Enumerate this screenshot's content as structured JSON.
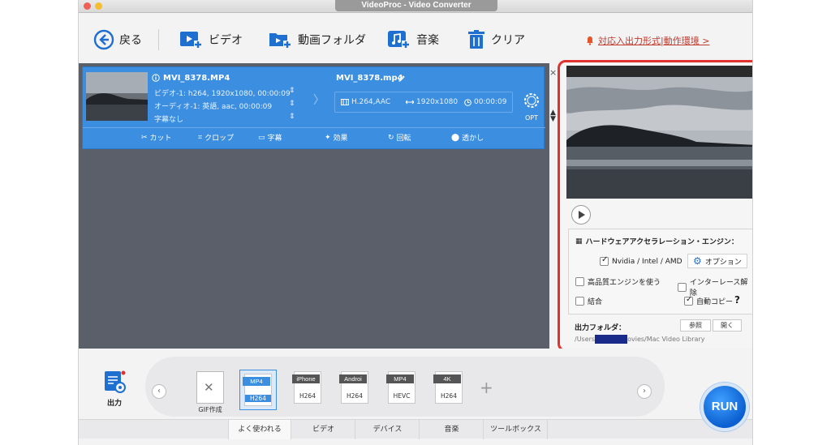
{
  "window": {
    "title": "VideoProc - Video Converter"
  },
  "toolbar": {
    "back": "戻る",
    "video": "ビデオ",
    "folder": "動画フォルダ",
    "music": "音楽",
    "clear": "クリア",
    "support_link": "対応入出力形式|動作環境 >"
  },
  "task": {
    "source_name": "MVI_8378.MP4",
    "video_track": "ビデオ-1: h264, 1920x1080, 00:00:09",
    "audio_track": "オーディオ-1: 英語, aac, 00:00:09",
    "subtitle": "字幕なし",
    "output_name": "MVI_8378.mp4",
    "codec": "H.264,AAC",
    "resolution": "1920x1080",
    "duration": "00:00:09",
    "opt_label": "OPT",
    "tools": {
      "cut": "カット",
      "crop": "クロップ",
      "subtitles": "字幕",
      "effects": "効果",
      "rotate": "回転",
      "watermark": "透かし"
    }
  },
  "panel": {
    "hw_title": "ハードウェアアクセラレーション・エンジン：",
    "nvidia": "Nvidia / Intel / AMD",
    "option": "オプション",
    "hq_engine": "高品質エンジンを使う",
    "deinterlace": "インターレース解除",
    "merge": "結合",
    "auto_copy": "自動コピー",
    "help": "?",
    "output_folder": "出力フォルダ：",
    "browse": "参照",
    "open": "開く",
    "path_prefix": "/Users",
    "path_suffix": "ovies/Mac Video Library"
  },
  "bottom": {
    "output_label": "出力",
    "gif_label": "GIF作成",
    "formats": [
      {
        "name": "MP4",
        "codec": "H264"
      },
      {
        "name": "iPhone",
        "codec": "H264"
      },
      {
        "name": "Androi",
        "codec": "H264"
      },
      {
        "name": "MP4",
        "codec": "HEVC"
      },
      {
        "name": "4K",
        "codec": "H264"
      }
    ],
    "tabs": [
      "よく使われる",
      "ビデオ",
      "デバイス",
      "音楽",
      "ツールボックス"
    ],
    "run": "RUN"
  },
  "colors": {
    "accent": "#3b8ee0",
    "highlight_border": "#e0322e",
    "run": "#0b5fd0"
  }
}
